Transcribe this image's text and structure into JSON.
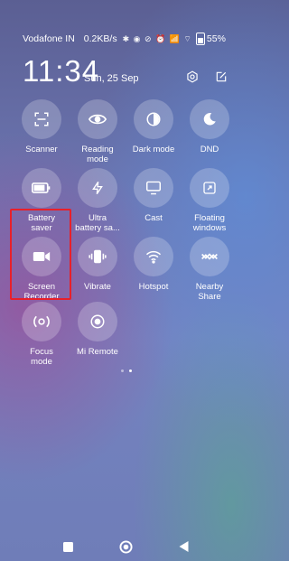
{
  "status": {
    "carrier": "Vodafone IN",
    "speed": "0.2KB/s",
    "icons": "✱ ◉ ⊘ ⏰ 📶 ⌔",
    "battery": "55"
  },
  "header": {
    "time": "11:34",
    "date": "Sun, 25 Sep"
  },
  "tiles": [
    {
      "label": "Scanner",
      "icon": "scanner-icon"
    },
    {
      "label": "Reading\nmode",
      "icon": "eye-icon"
    },
    {
      "label": "Dark mode",
      "icon": "dark-mode-icon"
    },
    {
      "label": "DND",
      "icon": "moon-icon"
    },
    {
      "label": "Battery\nsaver",
      "icon": "battery-icon"
    },
    {
      "label": "Ultra\nbattery sa...",
      "icon": "lightning-icon"
    },
    {
      "label": "Cast",
      "icon": "cast-icon"
    },
    {
      "label": "Floating\nwindows",
      "icon": "floating-window-icon"
    },
    {
      "label": "Screen\nRecorder",
      "icon": "video-camera-icon"
    },
    {
      "label": "Vibrate",
      "icon": "vibrate-icon"
    },
    {
      "label": "Hotspot",
      "icon": "wifi-hotspot-icon"
    },
    {
      "label": "Nearby\nShare",
      "icon": "nearby-share-icon"
    },
    {
      "label": "Focus\nmode",
      "icon": "focus-icon"
    },
    {
      "label": "Mi Remote",
      "icon": "remote-icon"
    }
  ],
  "pager": {
    "pages": 2,
    "current": 2
  },
  "colors": {
    "highlight": "#e8202a",
    "tile_bg": "rgba(255,255,255,0.22)"
  }
}
